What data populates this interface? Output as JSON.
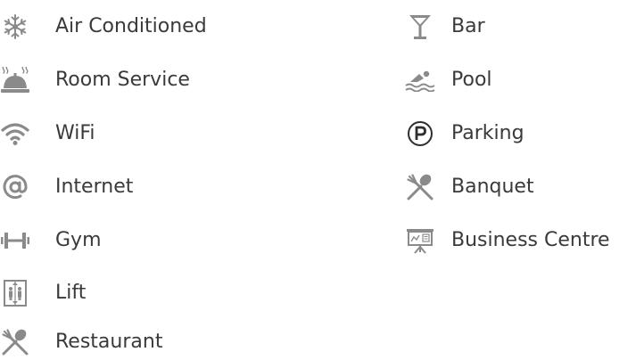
{
  "colors": {
    "icon": "#8a8a8a",
    "text": "#3a3a3a",
    "background": "#ffffff"
  },
  "amenities": {
    "left": [
      {
        "label": "Air Conditioned",
        "icon": "snowflake-icon"
      },
      {
        "label": "Room Service",
        "icon": "service-bell-icon"
      },
      {
        "label": "WiFi",
        "icon": "wifi-icon"
      },
      {
        "label": "Internet",
        "icon": "at-sign-icon"
      },
      {
        "label": "Gym",
        "icon": "dumbbell-icon"
      },
      {
        "label": "Lift",
        "icon": "elevator-icon"
      },
      {
        "label": "Restaurant",
        "icon": "fork-spoon-icon"
      }
    ],
    "right": [
      {
        "label": "Bar",
        "icon": "cocktail-glass-icon"
      },
      {
        "label": "Pool",
        "icon": "swimmer-icon"
      },
      {
        "label": "Parking",
        "icon": "parking-icon"
      },
      {
        "label": "Banquet",
        "icon": "fork-spoon-icon"
      },
      {
        "label": "Business Centre",
        "icon": "presentation-board-icon"
      }
    ]
  }
}
